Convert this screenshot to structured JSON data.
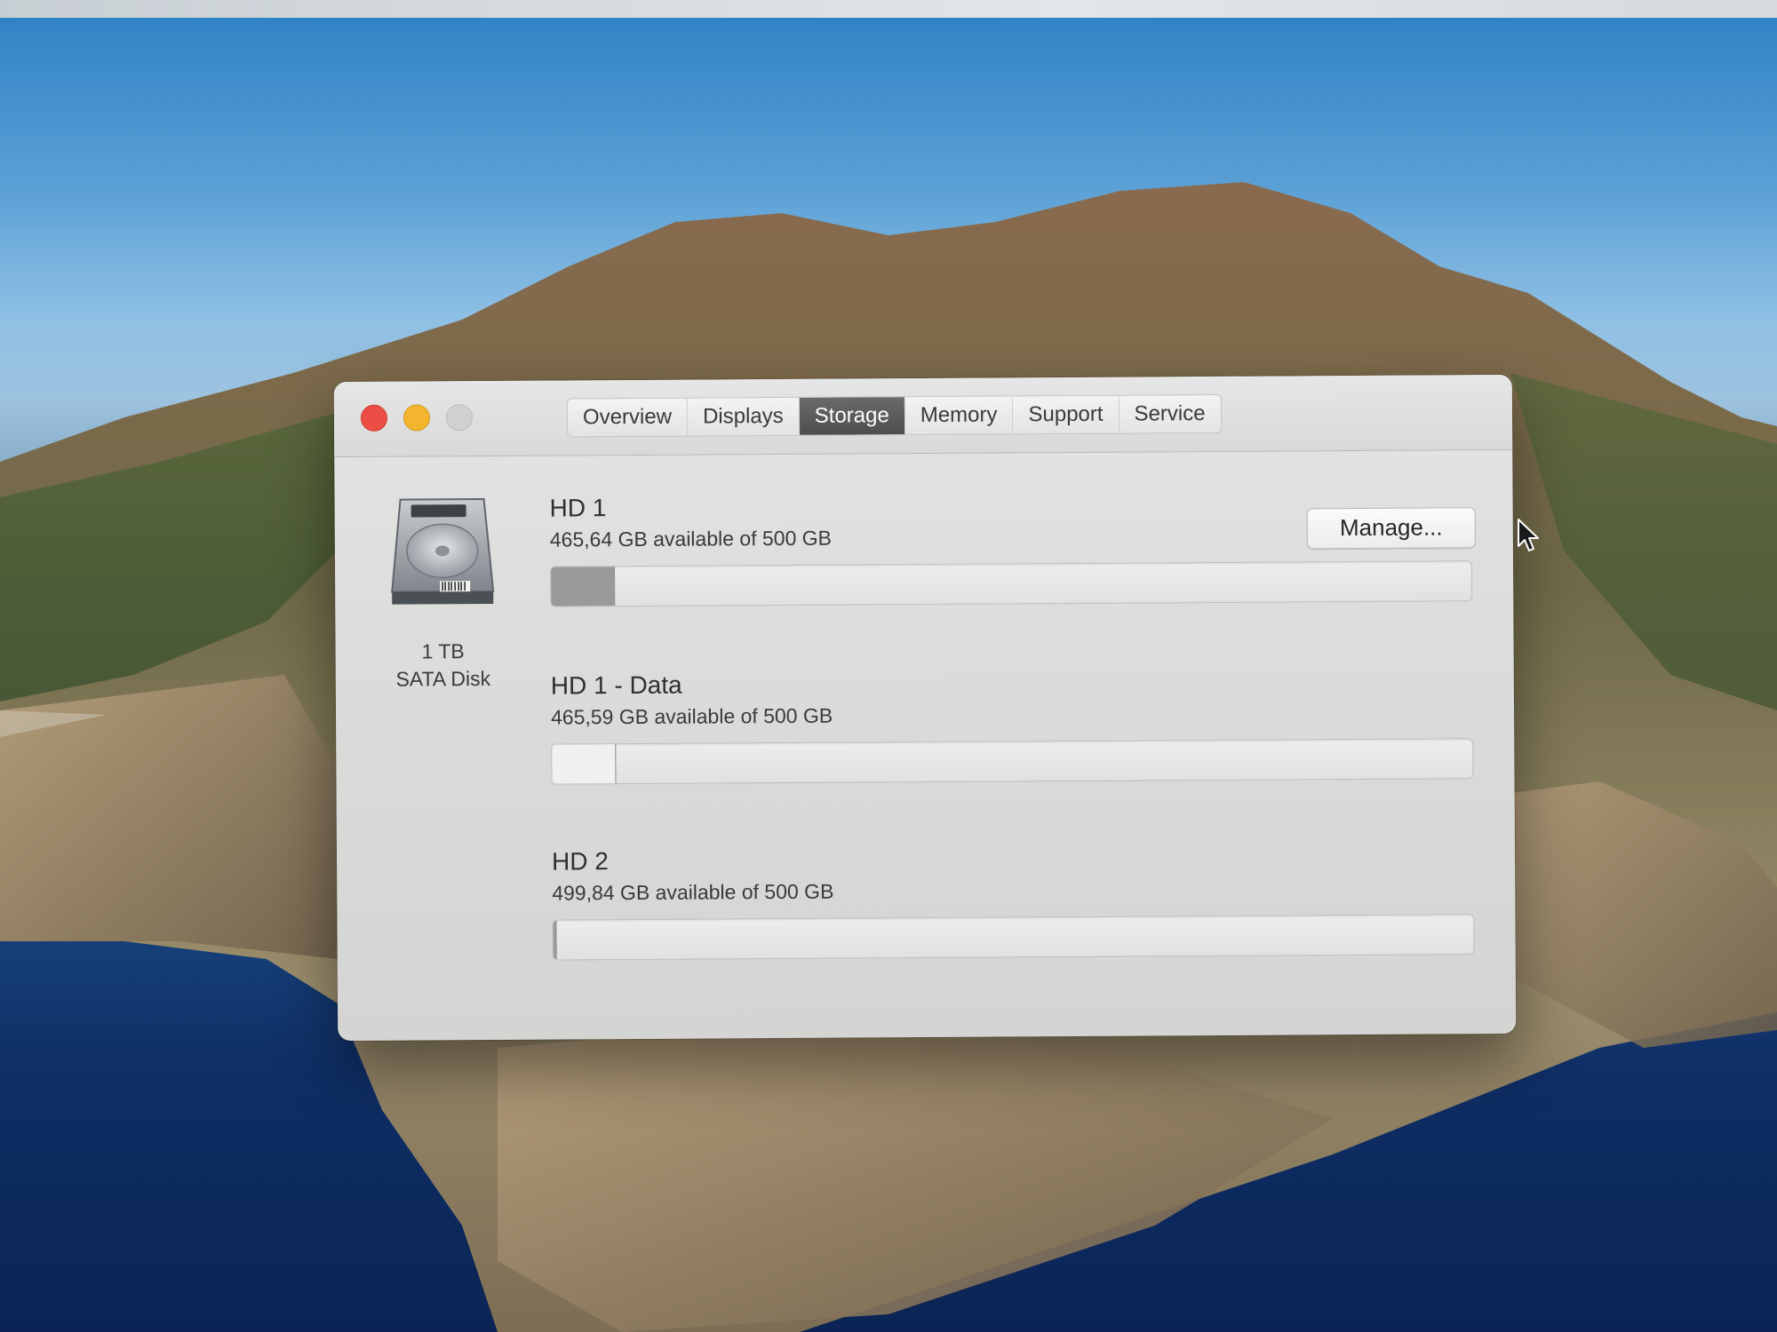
{
  "window": {
    "tabs": [
      {
        "label": "Overview",
        "active": false
      },
      {
        "label": "Displays",
        "active": false
      },
      {
        "label": "Storage",
        "active": true
      },
      {
        "label": "Memory",
        "active": false
      },
      {
        "label": "Support",
        "active": false
      },
      {
        "label": "Service",
        "active": false
      }
    ]
  },
  "disk": {
    "icon": "hard-drive-icon",
    "capacity": "1 TB",
    "type": "SATA Disk"
  },
  "manage_button": "Manage...",
  "volumes": [
    {
      "name": "HD 1",
      "available": "465,64 GB available of 500 GB",
      "used_fraction": 0.069,
      "fill_color": "#9a9a9a"
    },
    {
      "name": "HD 1 - Data",
      "available": "465,59 GB available of 500 GB",
      "used_fraction": 0.069,
      "fill_color": "#f0f0f0"
    },
    {
      "name": "HD 2",
      "available": "499,84 GB available of 500 GB",
      "used_fraction": 0.0003,
      "fill_color": "#9a9a9a"
    }
  ],
  "colors": {
    "active_tab": "#555555",
    "close": "#ec4e45",
    "minimize": "#f2b52d",
    "zoom_disabled": "#d0d0d0"
  }
}
